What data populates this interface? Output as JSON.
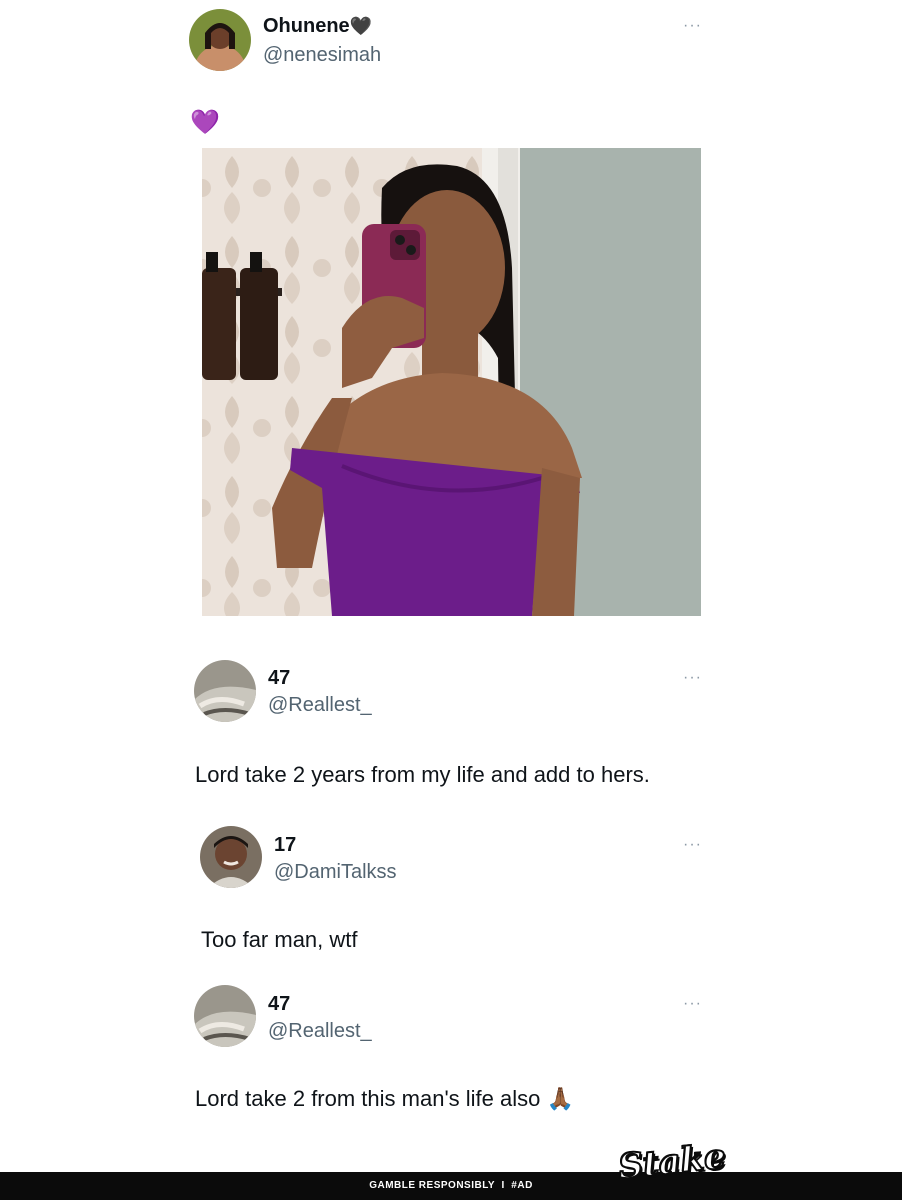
{
  "post": {
    "author_name": "Ohunene",
    "author_badge_emoji": "🖤",
    "handle": "@nenesimah",
    "text_emoji": "💜",
    "more_label": "···"
  },
  "replies": [
    {
      "name": "47",
      "handle": "@Reallest_",
      "text": "Lord take 2 years from my life and add to hers.",
      "more_label": "···"
    },
    {
      "name": "17",
      "handle": "@DamiTalkss",
      "text": "Too far man, wtf",
      "more_label": "···"
    },
    {
      "name": "47",
      "handle": "@Reallest_",
      "text": "Lord take 2 from this man's life also",
      "emoji": "🙏🏾",
      "more_label": "···"
    }
  ],
  "ad": {
    "brand": "Stake",
    "disclaimer": "GAMBLE RESPONSIBLY  I  #AD"
  },
  "colors": {
    "purple_dress": "#6a1b8a",
    "wallpaper": "#e9dfd6",
    "wall": "#a9b4ad",
    "ad_bar": "#0b0b0b"
  }
}
